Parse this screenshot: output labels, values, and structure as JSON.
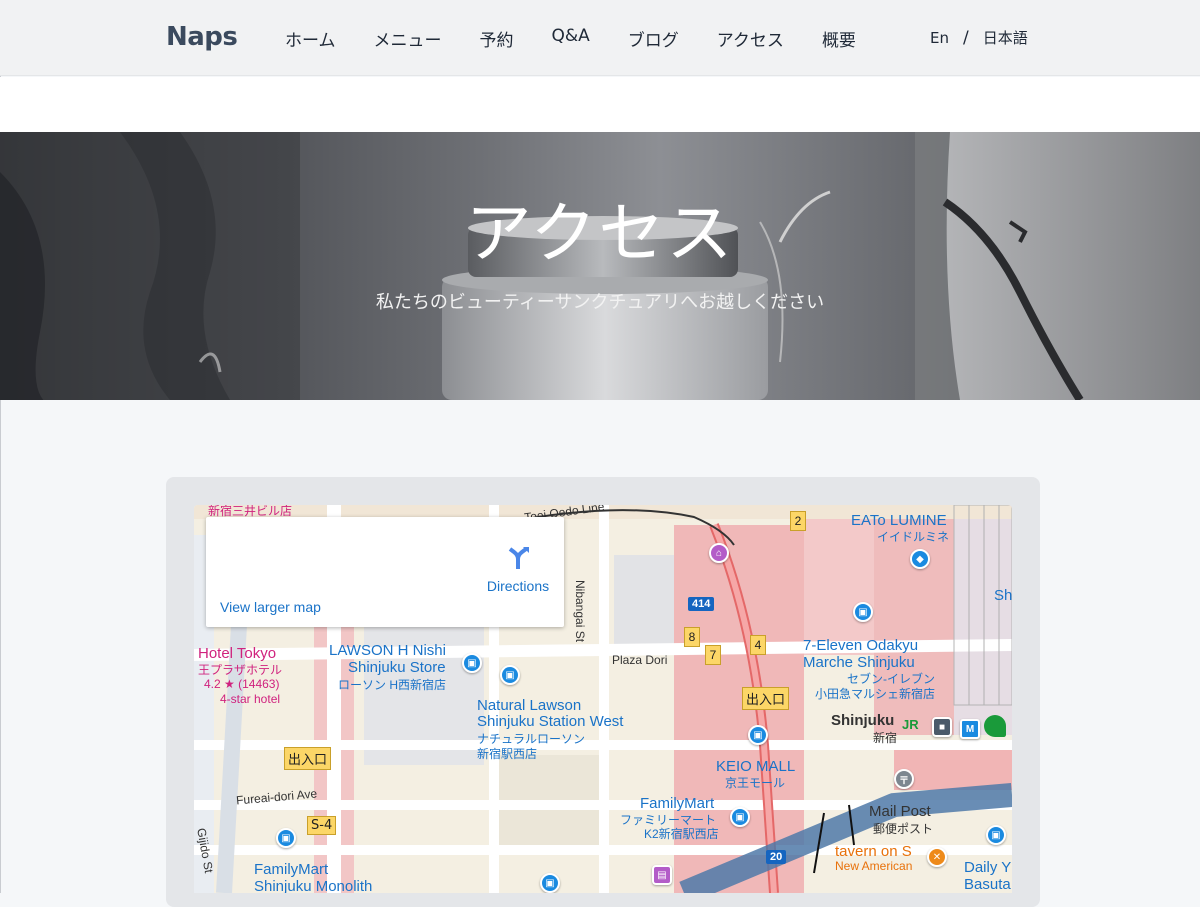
{
  "header": {
    "logo": "Naps",
    "nav": [
      "ホーム",
      "メニュー",
      "予約",
      "Q&A",
      "ブログ",
      "アクセス",
      "概要"
    ],
    "lang_en": "En",
    "lang_sep": "/",
    "lang_ja": "日本語"
  },
  "hero": {
    "title": "アクセス",
    "subtitle": "私たちのビューティーサンクチュアリへお越しください"
  },
  "map": {
    "infobox": {
      "directions_label": "Directions",
      "larger_map_label": "View larger map"
    },
    "labels": {
      "top_left_cut": "新宿三井ビル店",
      "toei_line": "Toei Oedo Line",
      "eato_en": "EATo LUMINE",
      "eato_ja": "イイドルミネ",
      "hotel_en": "Hotel Tokyo",
      "hotel_ja": "王プラザホテル",
      "hotel_rating": "4.2 ★ (14463)",
      "hotel_class": "4-star hotel",
      "lawson_h_1": "LAWSON H Nishi",
      "lawson_h_2": "Shinjuku Store",
      "lawson_h_ja": "ローソン H西新宿店",
      "nibangai": "Nibangai St",
      "plaza_dori": "Plaza Dori",
      "seven_1": "7-Eleven Odakyu",
      "seven_2": "Marche Shinjuku",
      "seven_ja1": "セブン-イレブン",
      "seven_ja2": "小田急マルシェ新宿店",
      "nat_lawson_1": "Natural Lawson",
      "nat_lawson_2": "Shinjuku Station West",
      "nat_lawson_ja1": "ナチュラルローソン",
      "nat_lawson_ja2": "新宿駅西店",
      "shinjuku_en": "Shinjuku",
      "shinjuku_ja": "新宿",
      "keio_en": "KEIO MALL",
      "keio_ja": "京王モール",
      "fureai": "Fureai-dori Ave",
      "familymart_1": "FamilyMart",
      "familymart_ja1": "ファミリーマート",
      "familymart_ja2": "K2新宿駅西店",
      "mailpost_en": "Mail Post",
      "mailpost_ja": "郵便ポスト",
      "tavern": "tavern on S",
      "tavern_sub": "New American",
      "gijido": "Gijido St",
      "fm_monolith_1": "FamilyMart",
      "fm_monolith_2": "Shinjuku Monolith",
      "daily_1": "Daily Y",
      "daily_2": "Basuta",
      "right_cut": "Sh",
      "exit_1": "出入口",
      "exit_2": "出入口",
      "exit_s4": "S-4",
      "num_2": "2",
      "num_4": "4",
      "num_7": "7",
      "num_8": "8",
      "route_414": "414",
      "route_20": "20"
    }
  }
}
